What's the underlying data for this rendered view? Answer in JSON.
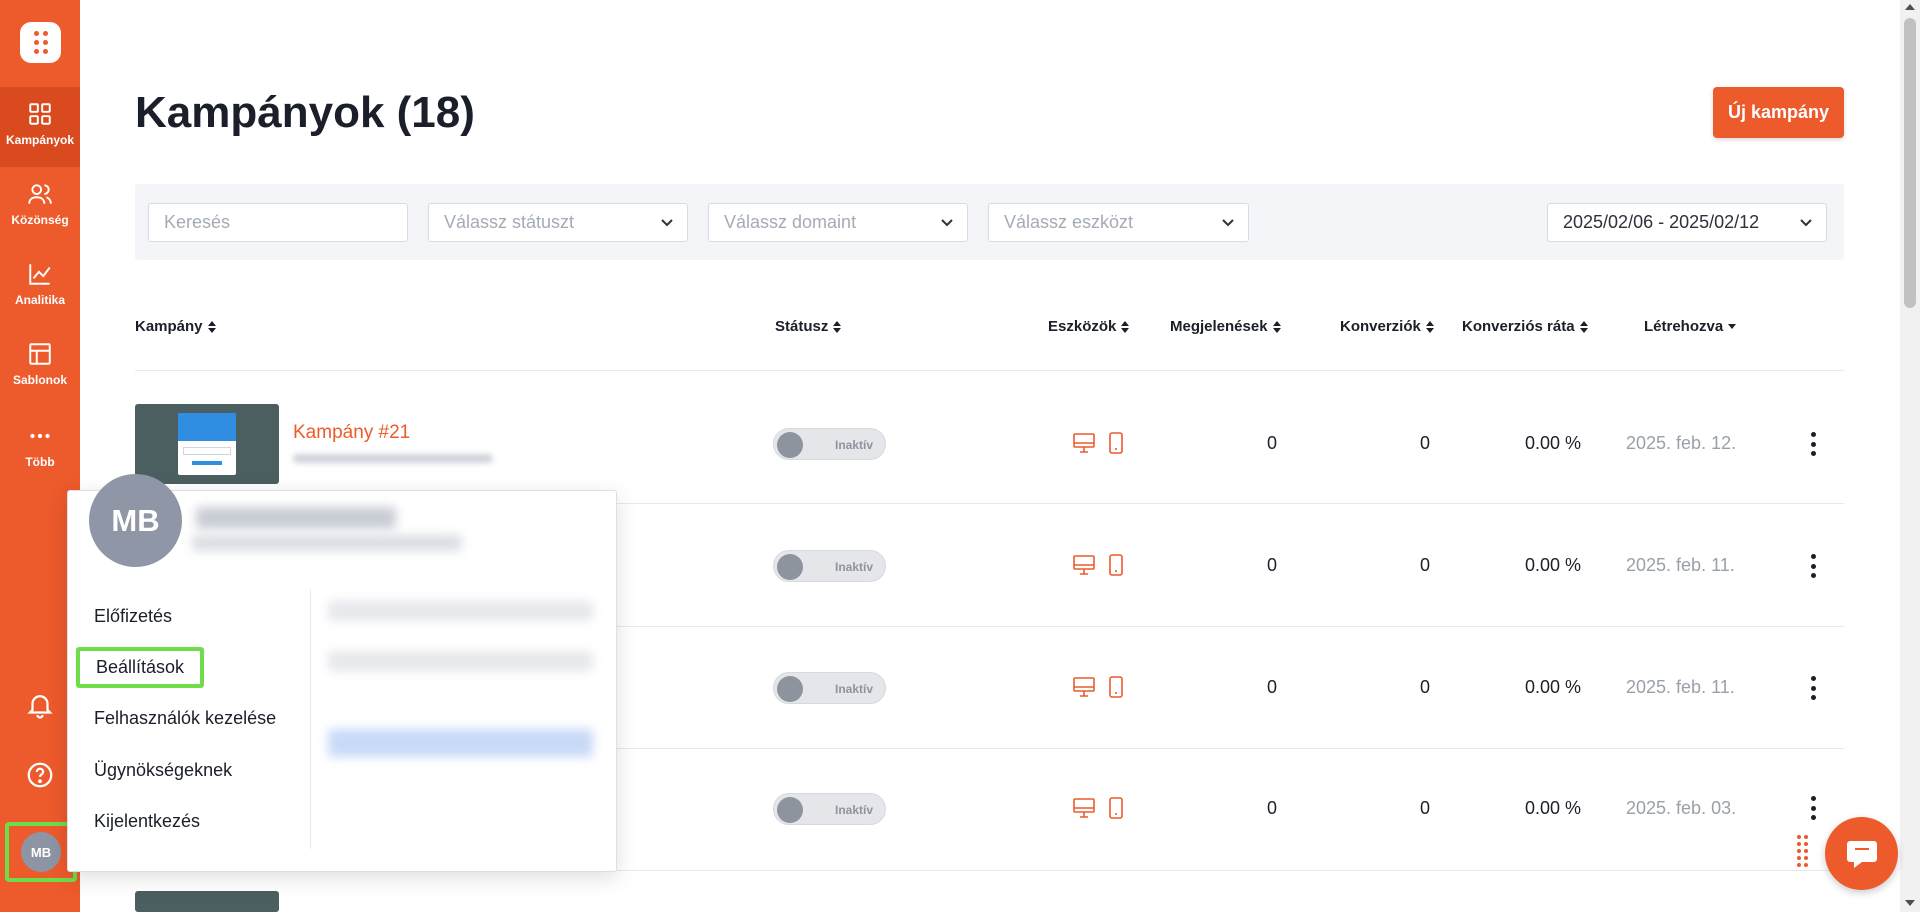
{
  "sidebar": {
    "items": [
      {
        "label": "Kampányok",
        "icon": "grid-icon",
        "active": true
      },
      {
        "label": "Közönség",
        "icon": "users-icon",
        "active": false
      },
      {
        "label": "Analitika",
        "icon": "chart-line-icon",
        "active": false
      },
      {
        "label": "Sablonok",
        "icon": "layout-icon",
        "active": false
      },
      {
        "label": "Több",
        "icon": "more-horizontal-icon",
        "active": false
      }
    ],
    "avatar_initials": "MB"
  },
  "header": {
    "title": "Kampányok (18)",
    "new_button": "Új kampány"
  },
  "filters": {
    "search_placeholder": "Keresés",
    "status_placeholder": "Válassz státuszt",
    "domain_placeholder": "Válassz domaint",
    "device_placeholder": "Válassz eszközt",
    "date_range": "2025/02/06 - 2025/02/12"
  },
  "table": {
    "columns": [
      "Kampány",
      "Státusz",
      "Eszközök",
      "Megjelenések",
      "Konverziók",
      "Konverziós ráta",
      "Létrehozva"
    ],
    "rows": [
      {
        "name": "Kampány #21",
        "status": "Inaktív",
        "impressions": "0",
        "conversions": "0",
        "rate": "0.00 %",
        "created": "2025. feb. 12."
      },
      {
        "name": "",
        "status": "Inaktív",
        "impressions": "0",
        "conversions": "0",
        "rate": "0.00 %",
        "created": "2025. feb. 11."
      },
      {
        "name": "",
        "status": "Inaktív",
        "impressions": "0",
        "conversions": "0",
        "rate": "0.00 %",
        "created": "2025. feb. 11."
      },
      {
        "name": "",
        "status": "Inaktív",
        "impressions": "0",
        "conversions": "0",
        "rate": "0.00 %",
        "created": "2025. feb. 03."
      }
    ]
  },
  "account_menu": {
    "avatar_initials": "MB",
    "items": [
      "Előfizetés",
      "Beállítások",
      "Felhasználók kezelése",
      "Ügynökségeknek",
      "Kijelentkezés"
    ],
    "highlighted_item": "Beállítások"
  },
  "colors": {
    "brand": "#ed5a2b",
    "highlight": "#6fdc4a",
    "avatar": "#8f96a6"
  }
}
